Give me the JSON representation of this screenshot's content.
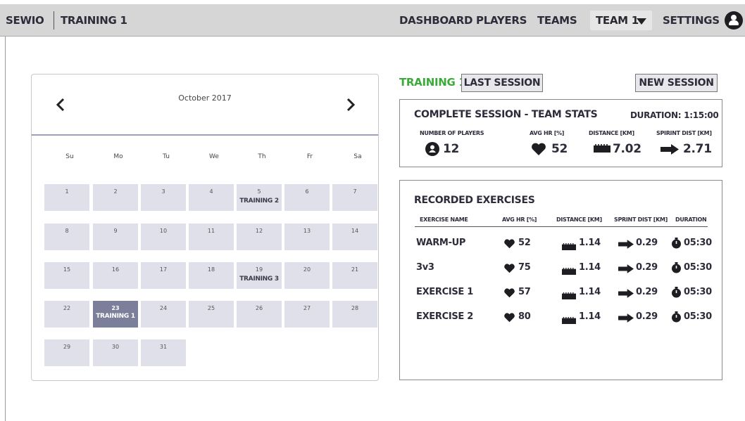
{
  "header": {
    "brand": "SEWIO",
    "crumb": "TRAINING 1",
    "nav": [
      "DASHBOARD",
      "PLAYERS",
      "TEAMS"
    ],
    "team_selected": "TEAM 1",
    "settings": "SETTINGS"
  },
  "calendar": {
    "month": "October 2017",
    "weekdays": [
      "Su",
      "Mo",
      "Tu",
      "We",
      "Th",
      "Fr",
      "Sa"
    ],
    "weeks": [
      [
        {
          "d": "1"
        },
        {
          "d": "2"
        },
        {
          "d": "3"
        },
        {
          "d": "4"
        },
        {
          "d": "5",
          "ev": "TRAINING 2"
        },
        {
          "d": "6"
        },
        {
          "d": "7"
        }
      ],
      [
        {
          "d": "8"
        },
        {
          "d": "9"
        },
        {
          "d": "10"
        },
        {
          "d": "11"
        },
        {
          "d": "12"
        },
        {
          "d": "13"
        },
        {
          "d": "14"
        }
      ],
      [
        {
          "d": "15"
        },
        {
          "d": "16"
        },
        {
          "d": "17"
        },
        {
          "d": "18"
        },
        {
          "d": "19",
          "ev": "TRAINING 3"
        },
        {
          "d": "20"
        },
        {
          "d": "21"
        }
      ],
      [
        {
          "d": "22"
        },
        {
          "d": "23",
          "ev": "TRAINING 1",
          "selected": true
        },
        {
          "d": "24"
        },
        {
          "d": "25"
        },
        {
          "d": "26"
        },
        {
          "d": "27"
        },
        {
          "d": "28"
        }
      ],
      [
        {
          "d": "29"
        },
        {
          "d": "30"
        },
        {
          "d": "31"
        }
      ]
    ]
  },
  "session": {
    "title": "TRAINING 1",
    "last_session": "LAST SESSION",
    "new_session": "NEW SESSION",
    "title_color": "#3caa3a"
  },
  "team_stats": {
    "heading": "COMPLETE SESSION - TEAM STATS",
    "duration": "DURATION: 1:15:00",
    "labels": {
      "players": "NUMBER OF PLAYERS",
      "hr": "AVG HR [%]",
      "distance": "DISTANCE [KM]",
      "sprint": "SPIRINT DIST [KM]"
    },
    "values": {
      "players": "12",
      "hr": "52",
      "distance": "7.02",
      "sprint": "2.71"
    }
  },
  "exercises": {
    "heading": "RECORDED EXERCISES",
    "columns": [
      "EXERCISE NAME",
      "AVG HR [%]",
      "DISTANCE [KM]",
      "SPRINT DIST [KM]",
      "DURATION"
    ],
    "rows": [
      {
        "name": "WARM-UP",
        "hr": "52",
        "dist": "1.14",
        "sprint": "0.29",
        "dur": "05:30"
      },
      {
        "name": "3v3",
        "hr": "75",
        "dist": "1.14",
        "sprint": "0.29",
        "dur": "05:30"
      },
      {
        "name": "EXERCISE 1",
        "hr": "57",
        "dist": "1.14",
        "sprint": "0.29",
        "dur": "05:30"
      },
      {
        "name": "EXERCISE 2",
        "hr": "80",
        "dist": "1.14",
        "sprint": "0.29",
        "dur": "05:30"
      }
    ]
  },
  "icons": {
    "prev": "chevron-left-icon",
    "next": "chevron-right-icon",
    "players": "user-circle-icon",
    "hr": "heart-icon",
    "distance": "ruler-icon",
    "sprint": "arrow-right-icon",
    "duration": "stopwatch-icon",
    "dropdown": "caret-down-icon",
    "avatar": "user-avatar-icon"
  }
}
